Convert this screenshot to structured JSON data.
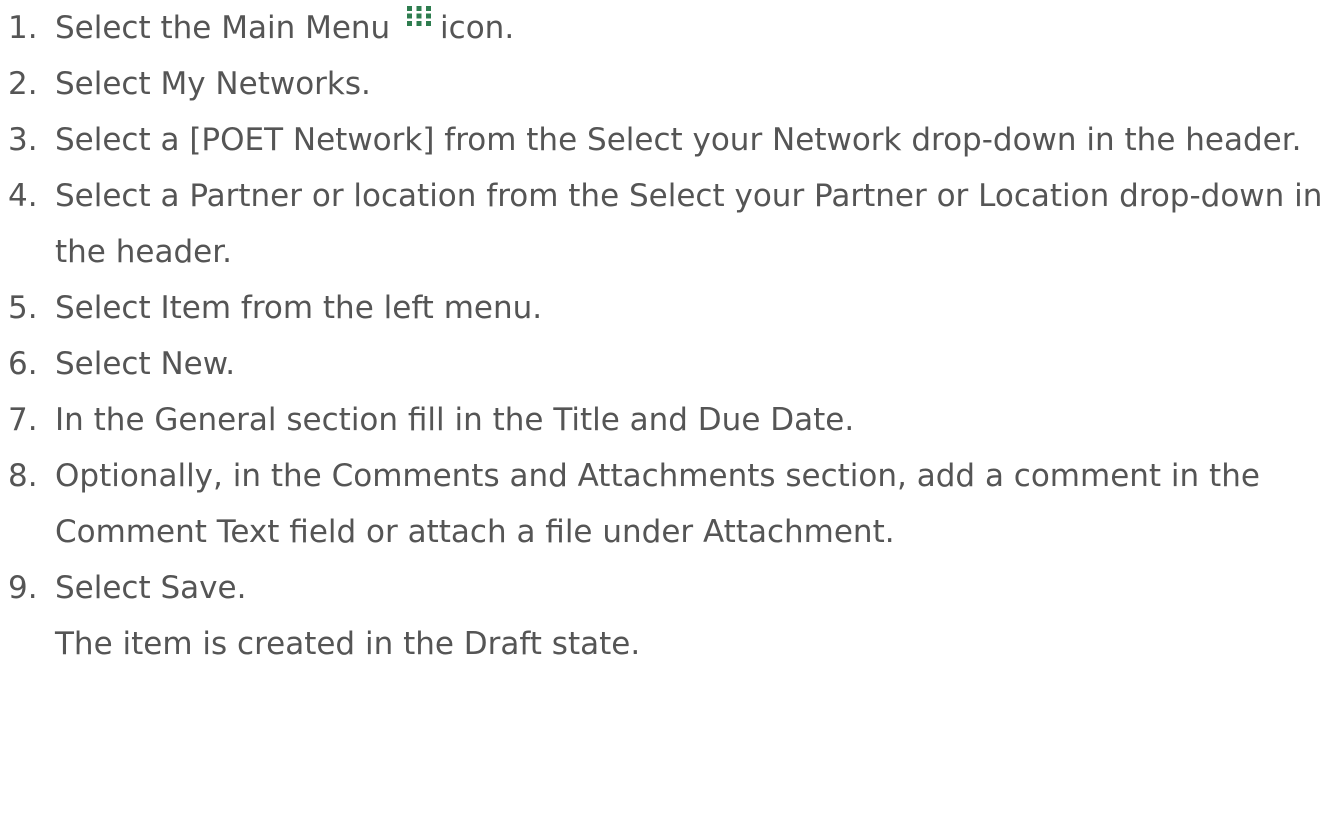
{
  "steps": [
    {
      "num": "1.",
      "before": "Select the Main Menu",
      "icon": "main-menu-grid-icon",
      "after": "icon."
    },
    {
      "num": "2.",
      "text": "Select My Networks."
    },
    {
      "num": "3.",
      "text": "Select a [POET Network] from the Select your Network drop-down in the header."
    },
    {
      "num": "4.",
      "text": "Select a Partner or location from the Select your Partner or Location drop-down in the header."
    },
    {
      "num": "5.",
      "text": "Select Item from the left menu."
    },
    {
      "num": "6.",
      "text": "Select New."
    },
    {
      "num": "7.",
      "text": "In the General section fill in the Title and Due Date."
    },
    {
      "num": "8.",
      "text": "Optionally, in the Comments and Attachments section, add a comment in the Comment Text field or attach a file under Attachment."
    },
    {
      "num": "9.",
      "text": "Select Save."
    }
  ],
  "result_note": "The item is created in the Draft state.",
  "colors": {
    "text": "#555555",
    "icon": "#2e7d4f"
  }
}
